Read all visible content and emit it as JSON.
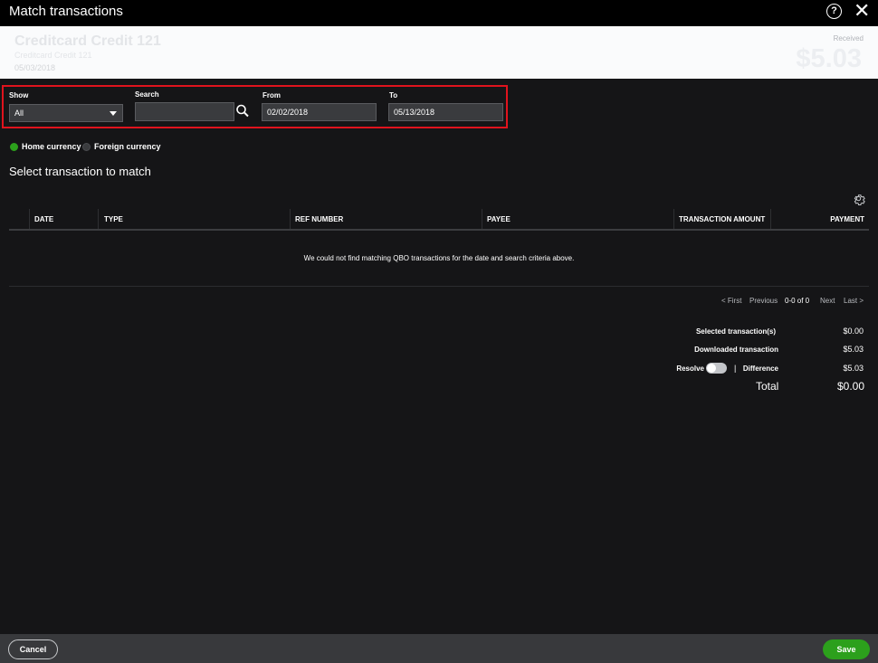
{
  "window": {
    "title": "Match transactions",
    "help_icon": "question-circle-icon",
    "close_icon": "close-icon"
  },
  "transaction": {
    "description": "Creditcard Credit 121",
    "subtitle": "Creditcard Credit 121",
    "date": "05/03/2018",
    "amount_label": "Received",
    "amount": "$5.03"
  },
  "filters": {
    "show_label": "Show",
    "show_value": "All",
    "search_label": "Search",
    "search_value": "",
    "from_label": "From",
    "from_value": "02/02/2018",
    "to_label": "To",
    "to_value": "05/13/2018",
    "highlight_color": "#e0131d"
  },
  "currency": {
    "home": "Home currency",
    "foreign": "Foreign currency",
    "selected": "home",
    "selected_color": "#2ca01c"
  },
  "section_title": "Select transaction to match",
  "table": {
    "columns": [
      "DATE",
      "TYPE",
      "REF NUMBER",
      "PAYEE",
      "TRANSACTION AMOUNT",
      "PAYMENT"
    ],
    "rows": [],
    "empty_message": "We could not find matching QBO transactions for the date and search criteria above."
  },
  "pagination": {
    "first": "< First",
    "previous": "Previous",
    "count": "0-0 of 0",
    "next": "Next",
    "last": "Last >"
  },
  "summary": {
    "selected_label": "Selected transaction(s)",
    "selected_value": "$0.00",
    "downloaded_label": "Downloaded transaction",
    "downloaded_value": "$5.03",
    "resolve_label": "Resolve",
    "resolve_on": false,
    "separator": "|",
    "difference_label": "Difference",
    "difference_value": "$5.03",
    "total_label": "Total",
    "total_value": "$0.00"
  },
  "footer": {
    "cancel": "Cancel",
    "save": "Save",
    "save_color": "#2ca01c"
  }
}
